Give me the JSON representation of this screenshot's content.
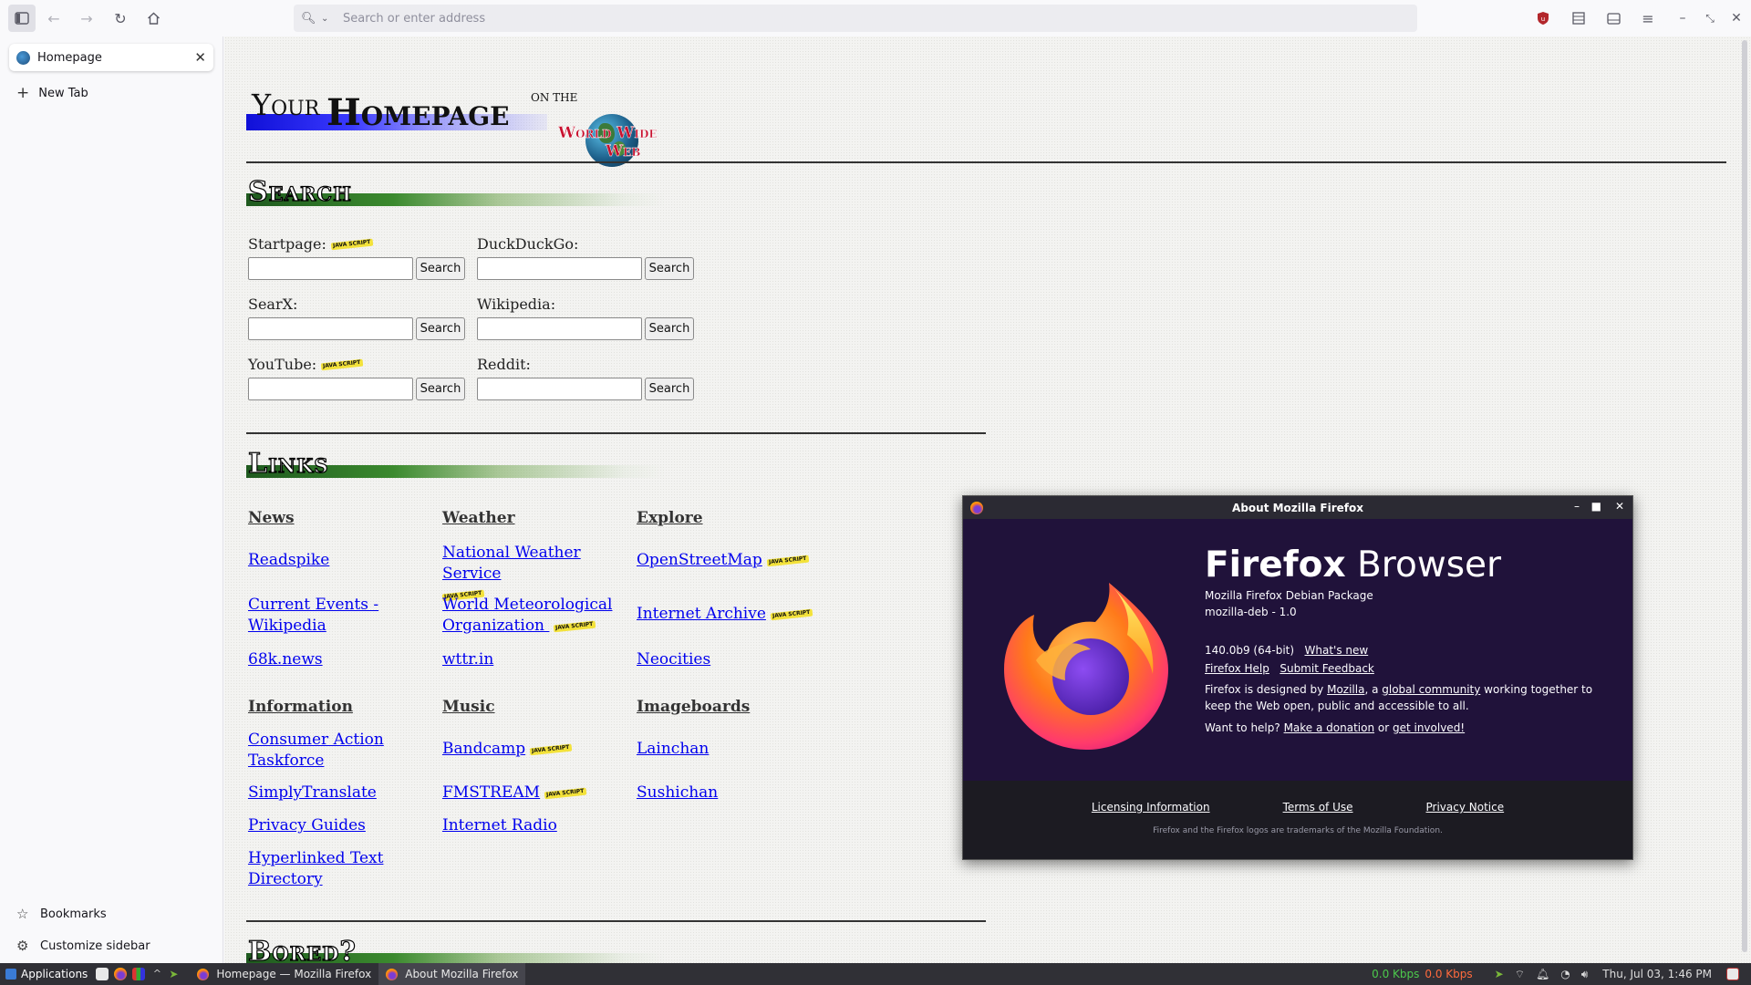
{
  "toolbar": {
    "url_placeholder": "Search or enter address"
  },
  "sidebar": {
    "tab_title": "Homepage",
    "new_tab": "New Tab",
    "bookmarks": "Bookmarks",
    "customize": "Customize sidebar"
  },
  "page": {
    "logo": {
      "your": "Your",
      "homepage": "Homepage",
      "on_the": "ON THE",
      "world_wide": "World Wide",
      "web": "Web"
    },
    "search_heading": "Search",
    "links_heading": "Links",
    "bored_heading": "Bored?",
    "js_badge": "JAVA SCRIPT",
    "search_button": "Search",
    "search_engines": [
      {
        "label": "Startpage:",
        "js": true
      },
      {
        "label": "DuckDuckGo:",
        "js": false
      },
      {
        "label": "SearX:",
        "js": false
      },
      {
        "label": "Wikipedia:",
        "js": false
      },
      {
        "label": "YouTube:",
        "js": true
      },
      {
        "label": "Reddit:",
        "js": false
      }
    ],
    "link_columns": [
      {
        "heading": "News",
        "links": [
          "Readspike",
          "Current Events - Wikipedia",
          "68k.news"
        ]
      },
      {
        "heading": "Weather",
        "links": [
          "National Weather Service",
          "World Meteorological Organization",
          "wttr.in"
        ]
      },
      {
        "heading": "Explore",
        "links": [
          "OpenStreetMap",
          "Internet Archive",
          "Neocities"
        ]
      },
      {
        "heading": "Information",
        "links": [
          "Consumer Action Taskforce",
          "SimplyTranslate",
          "Privacy Guides",
          "Hyperlinked Text Directory"
        ]
      },
      {
        "heading": "Music",
        "links": [
          "Bandcamp",
          "FMSTREAM",
          "Internet Radio"
        ]
      },
      {
        "heading": "Imageboards",
        "links": [
          "Lainchan",
          "Sushichan"
        ]
      }
    ]
  },
  "about": {
    "title": "About Mozilla Firefox",
    "brand_bold": "Firefox",
    "brand_light": "Browser",
    "package": "Mozilla Firefox Debian Package",
    "package_id": "mozilla-deb - 1.0",
    "version": "140.0b9 (64-bit)",
    "whats_new": "What's new",
    "help": "Firefox Help",
    "feedback": "Submit Feedback",
    "designed_1": "Firefox is designed by ",
    "mozilla": "Mozilla",
    "designed_2": ", a ",
    "global_community": "global community",
    "designed_3": " working together to",
    "designed_4": "keep the Web open, public and accessible to all.",
    "help_prompt": "Want to help? ",
    "donation": "Make a donation",
    "or": " or ",
    "involved": "get involved!",
    "licensing": "Licensing Information",
    "terms": "Terms of Use",
    "privacy": "Privacy Notice",
    "trademark": "Firefox and the Firefox logos are trademarks of the Mozilla Foundation."
  },
  "taskbar": {
    "applications": "Applications",
    "task1": "Homepage — Mozilla Firefox",
    "task2": "About Mozilla Firefox",
    "net_down": "0.0 Kbps",
    "net_up": "0.0 Kbps",
    "clock": "Thu, Jul 03,   1:46 PM"
  }
}
